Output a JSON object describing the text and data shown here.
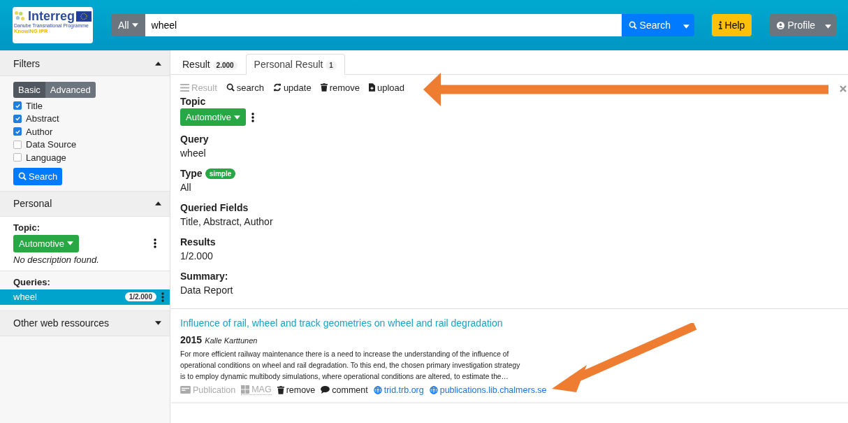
{
  "logo": {
    "title": "Interreg",
    "subtitle": "Danube Transnational Programme",
    "project": "KnowING IPR"
  },
  "header": {
    "scope": "All",
    "query": "wheel",
    "search_button": "Search",
    "help_button": "Help",
    "profile_button": "Profile"
  },
  "sidebar": {
    "filters": {
      "title": "Filters",
      "expanded": true,
      "modes": [
        {
          "label": "Basic",
          "selected": true
        },
        {
          "label": "Advanced",
          "selected": false
        }
      ],
      "fields": [
        {
          "label": "Title",
          "checked": true
        },
        {
          "label": "Abstract",
          "checked": true
        },
        {
          "label": "Author",
          "checked": true
        },
        {
          "label": "Data Source",
          "checked": false
        },
        {
          "label": "Language",
          "checked": false
        }
      ],
      "search_button": "Search"
    },
    "personal": {
      "title": "Personal",
      "expanded": true,
      "topic_label": "Topic:",
      "topic": "Automotive",
      "description": "No description found.",
      "queries_label": "Queries:",
      "queries": [
        {
          "label": "wheel",
          "count": "1/2.000",
          "selected": true
        }
      ]
    },
    "other": {
      "title": "Other web ressources",
      "expanded": false
    }
  },
  "tabs": [
    {
      "label": "Result",
      "count": "2.000",
      "selected": false
    },
    {
      "label": "Personal Result",
      "count": "1",
      "selected": true
    }
  ],
  "toolbar": [
    {
      "kind": "list",
      "label": "Result",
      "disabled": true
    },
    {
      "kind": "search",
      "label": "search",
      "disabled": false
    },
    {
      "kind": "update",
      "label": "update",
      "disabled": false
    },
    {
      "kind": "remove",
      "label": "remove",
      "disabled": false
    },
    {
      "kind": "upload",
      "label": "upload",
      "disabled": false
    }
  ],
  "details": {
    "topic_label": "Topic",
    "topic": "Automotive",
    "query_label": "Query",
    "query": "wheel",
    "type_label": "Type",
    "type_badge": "simple",
    "type": "All",
    "fields_label": "Queried Fields",
    "fields": "Title, Abstract, Author",
    "results_label": "Results",
    "results": "1/2.000",
    "summary_label": "Summary:",
    "summary": "Data Report"
  },
  "results": [
    {
      "title": "Influence of rail, wheel and track geometries on wheel and rail degradation",
      "year": "2015",
      "author": "Kalle Karttunen",
      "abstract": [
        "For more efficient railway maintenance there is a need to increase the understanding of the influence of",
        "operational conditions on wheel and rail degradation. To this end, the chosen primary investigation strategy",
        "is to employ dynamic multibody simulations, where operational conditions are altered, to estimate the…"
      ],
      "actions": [
        {
          "kind": "type",
          "label": "Publication"
        },
        {
          "kind": "source",
          "label": "MAG"
        },
        {
          "kind": "remove",
          "label": "remove"
        },
        {
          "kind": "comment",
          "label": "comment"
        },
        {
          "kind": "link",
          "label": "trid.trb.org"
        },
        {
          "kind": "link",
          "label": "publications.lib.chalmers.se"
        }
      ]
    }
  ]
}
